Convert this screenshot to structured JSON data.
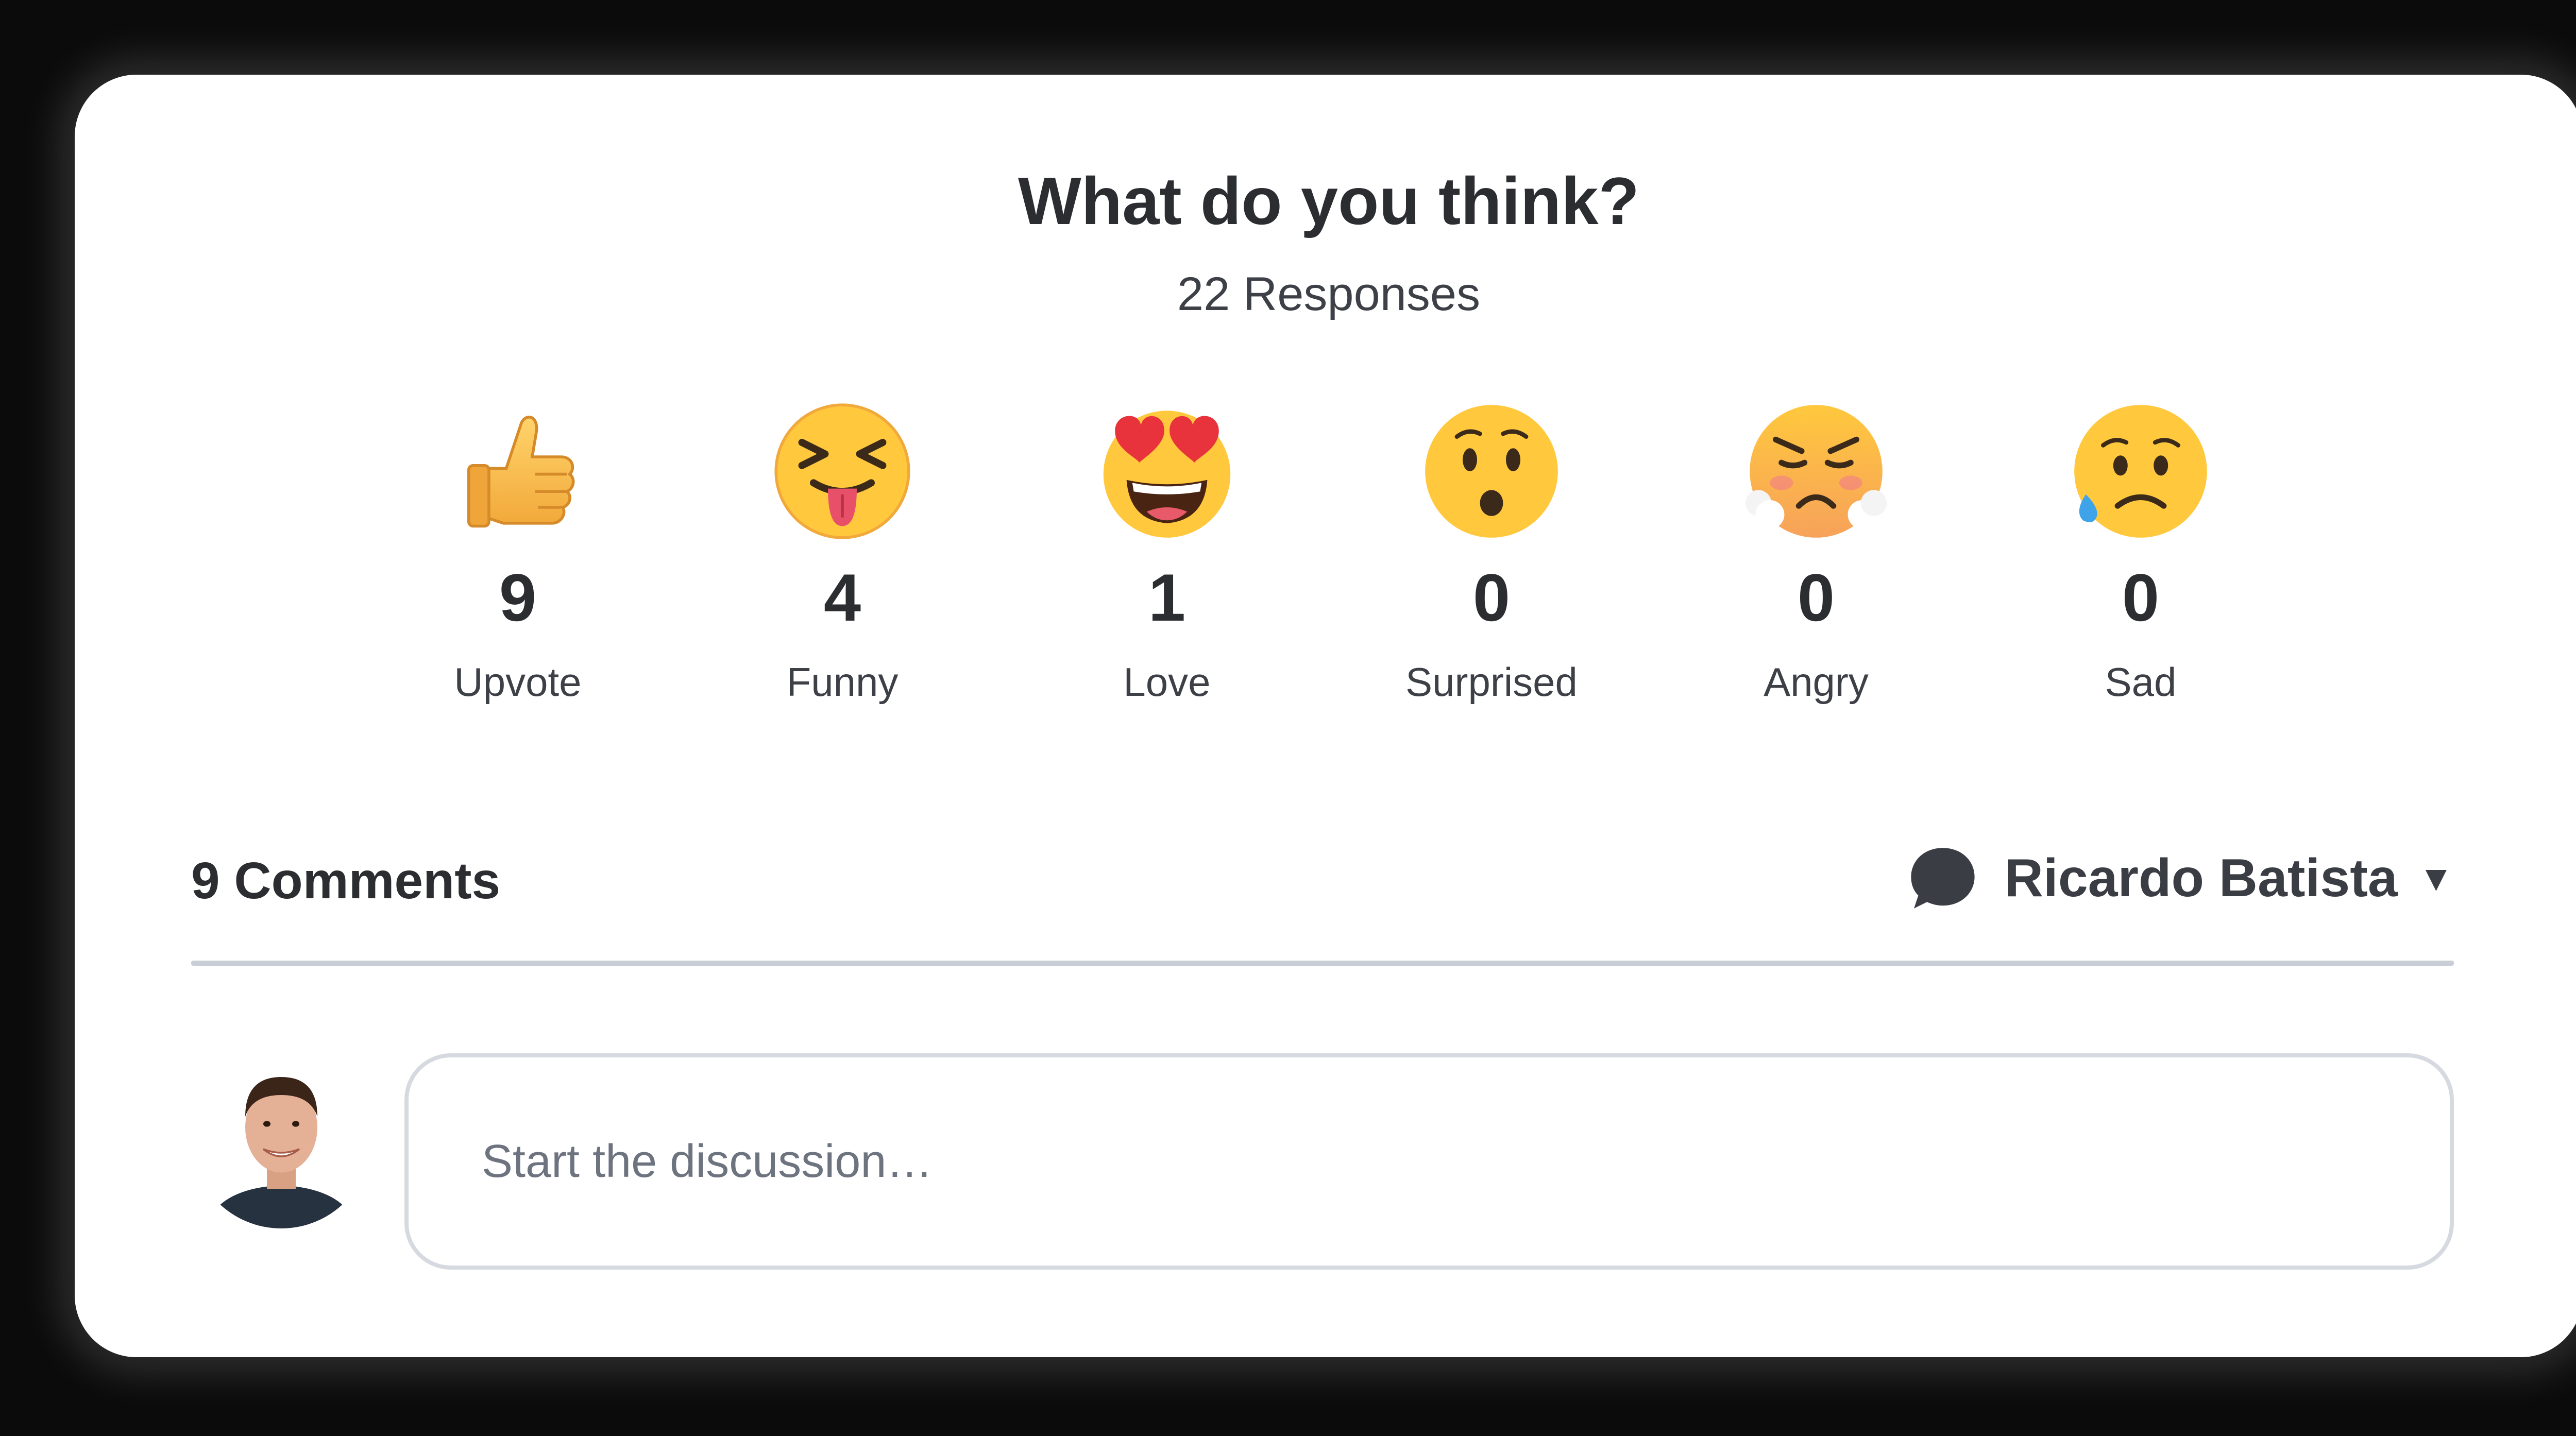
{
  "header": {
    "title": "What do you think?",
    "responses": "22 Responses"
  },
  "reactions": [
    {
      "icon": "thumbs-up-icon",
      "count": "9",
      "label": "Upvote"
    },
    {
      "icon": "squinting-tongue-face-icon",
      "count": "4",
      "label": "Funny"
    },
    {
      "icon": "heart-eyes-face-icon",
      "count": "1",
      "label": "Love"
    },
    {
      "icon": "surprised-face-icon",
      "count": "0",
      "label": "Surprised"
    },
    {
      "icon": "angry-steam-face-icon",
      "count": "0",
      "label": "Angry"
    },
    {
      "icon": "sad-sweat-face-icon",
      "count": "0",
      "label": "Sad"
    }
  ],
  "comments": {
    "count_label": "9 Comments",
    "user_name": "Ricardo Batista",
    "caret": "▼",
    "input_placeholder": "Start the discussion…"
  },
  "colors": {
    "emoji_yellow": "#ffc83d",
    "text_dark": "#2b2d31",
    "divider": "#c9ced6",
    "heart_red": "#e8323c"
  }
}
